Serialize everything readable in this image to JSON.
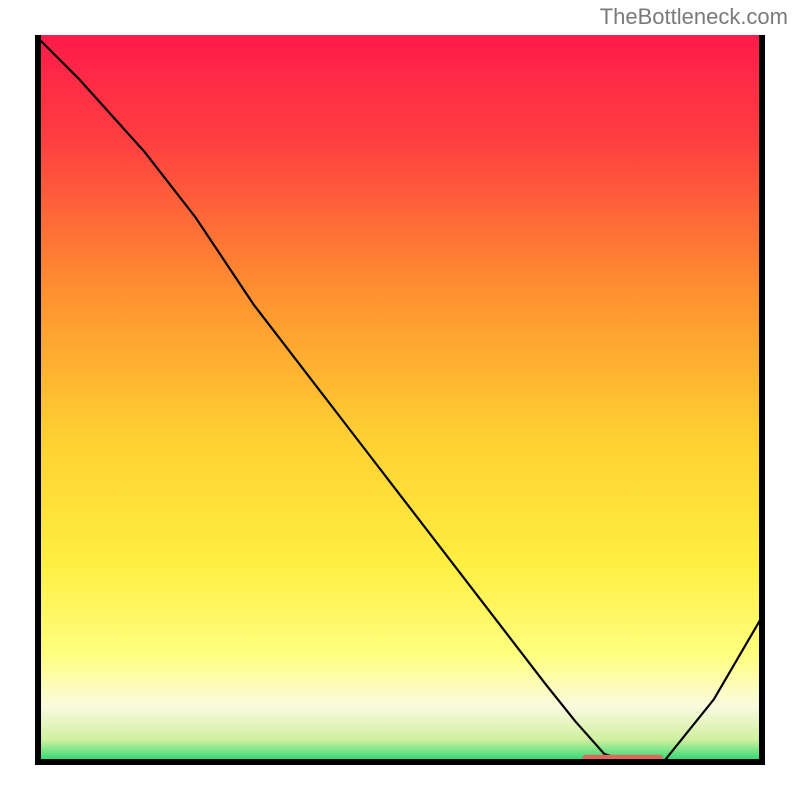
{
  "watermark": "TheBottleneck.com",
  "chart_data": {
    "type": "line",
    "title": "",
    "xlabel": "",
    "ylabel": "",
    "xlim": [
      0,
      100
    ],
    "ylim": [
      0,
      100
    ],
    "grid": false,
    "legend": false,
    "background_gradient": {
      "stops": [
        {
          "offset": 0.0,
          "color": "#ff1a4a"
        },
        {
          "offset": 0.15,
          "color": "#ff4040"
        },
        {
          "offset": 0.35,
          "color": "#ff9030"
        },
        {
          "offset": 0.55,
          "color": "#ffd032"
        },
        {
          "offset": 0.72,
          "color": "#ffee40"
        },
        {
          "offset": 0.85,
          "color": "#ffff80"
        },
        {
          "offset": 0.92,
          "color": "#fafae0"
        },
        {
          "offset": 0.965,
          "color": "#d0f0a0"
        },
        {
          "offset": 0.985,
          "color": "#60e080"
        },
        {
          "offset": 1.0,
          "color": "#00d070"
        }
      ]
    },
    "series": [
      {
        "name": "bottleneck-curve",
        "color": "#000000",
        "x": [
          0,
          6,
          15,
          22,
          30,
          40,
          50,
          60,
          70,
          74,
          78,
          82,
          86,
          93,
          100
        ],
        "values": [
          100,
          94,
          84,
          75,
          63,
          50,
          37,
          24,
          11,
          6,
          1.5,
          0.3,
          0.3,
          9,
          21
        ]
      }
    ],
    "marker": {
      "name": "optimal-range",
      "color": "#e0695f",
      "x_start": 75,
      "x_end": 86,
      "y": 1.0
    },
    "frame": {
      "color": "#000000",
      "left_right_width": 6,
      "bottom_width": 6,
      "top": false
    }
  }
}
